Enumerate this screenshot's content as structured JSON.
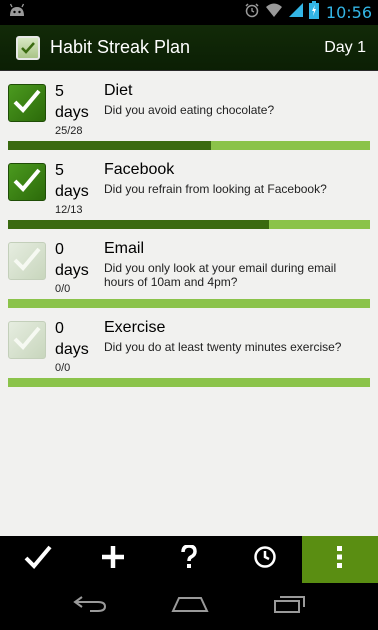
{
  "status_bar": {
    "time": "10:56",
    "icons": [
      "android-icon",
      "alarm-icon",
      "wifi-icon",
      "signal-icon",
      "battery-icon"
    ]
  },
  "action_bar": {
    "title": "Habit Streak Plan",
    "day": "Day 1",
    "icon": "checkbox-icon"
  },
  "habits": [
    {
      "name": "Diet",
      "streak": "5",
      "unit": "days",
      "ratio": "25/28",
      "question": "Did you avoid eating chocolate?",
      "checked": true,
      "progress": 0.56
    },
    {
      "name": "Facebook",
      "streak": "5",
      "unit": "days",
      "ratio": "12/13",
      "question": "Did you refrain from looking at Facebook?",
      "checked": true,
      "progress": 0.72
    },
    {
      "name": "Email",
      "streak": "0",
      "unit": "days",
      "ratio": "0/0",
      "question": "Did you only look at your email during email hours of 10am and 4pm?",
      "checked": false,
      "progress": 0
    },
    {
      "name": "Exercise",
      "streak": "0",
      "unit": "days",
      "ratio": "0/0",
      "question": "Did you do at least twenty minutes exercise?",
      "checked": false,
      "progress": 0
    }
  ],
  "toolbar": {
    "buttons": [
      "check-icon",
      "plus-icon",
      "question-icon",
      "clock-icon",
      "overflow-menu-icon"
    ]
  },
  "colors": {
    "accent": "#5a8e12",
    "bar_bg": "#8bc34a",
    "bar_fill": "#3a6a10",
    "status_text": "#33b5e5"
  }
}
